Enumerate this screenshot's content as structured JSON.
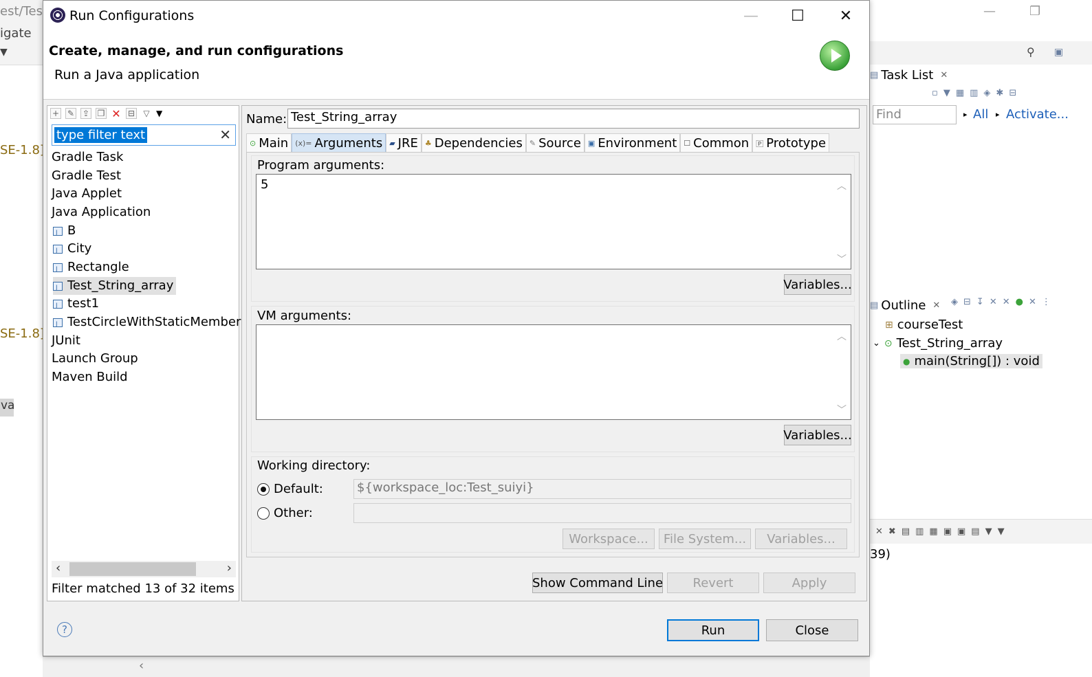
{
  "background": {
    "left_texts": [
      "est/Tes",
      "igate",
      "SE-1.8]",
      "SE-1.8]",
      "va"
    ],
    "task_list": {
      "title": "Task List",
      "find_placeholder": "Find",
      "all_link": "All",
      "activate_link": "Activate..."
    },
    "outline": {
      "title": "Outline",
      "items": [
        {
          "label": "courseTest"
        },
        {
          "label": "Test_String_array"
        },
        {
          "label": "main(String[]) : void"
        }
      ]
    },
    "console_text": "39)"
  },
  "dialog": {
    "title": "Run Configurations",
    "header_title": "Create, manage, and run configurations",
    "header_subtitle": "Run a Java application",
    "filter_placeholder": "type filter text",
    "tree": [
      {
        "label": "Gradle Task",
        "child": false
      },
      {
        "label": "Gradle Test",
        "child": false
      },
      {
        "label": "Java Applet",
        "child": false
      },
      {
        "label": "Java Application",
        "child": false
      },
      {
        "label": "B",
        "child": true
      },
      {
        "label": "City",
        "child": true
      },
      {
        "label": "Rectangle",
        "child": true
      },
      {
        "label": "Test_String_array",
        "child": true,
        "selected": true
      },
      {
        "label": "test1",
        "child": true
      },
      {
        "label": "TestCircleWithStaticMember",
        "child": true
      },
      {
        "label": "JUnit",
        "child": false
      },
      {
        "label": "Launch Group",
        "child": false
      },
      {
        "label": "Maven Build",
        "child": false
      }
    ],
    "filter_status": "Filter matched 13 of 32 items",
    "name_label": "Name:",
    "name_value": "Test_String_array",
    "tabs": [
      {
        "label": "Main",
        "icon": "main-tab-icon"
      },
      {
        "label": "Arguments",
        "icon": "arguments-tab-icon",
        "active": true
      },
      {
        "label": "JRE",
        "icon": "jre-tab-icon"
      },
      {
        "label": "Dependencies",
        "icon": "dependencies-tab-icon"
      },
      {
        "label": "Source",
        "icon": "source-tab-icon"
      },
      {
        "label": "Environment",
        "icon": "environment-tab-icon"
      },
      {
        "label": "Common",
        "icon": "common-tab-icon"
      },
      {
        "label": "Prototype",
        "icon": "prototype-tab-icon"
      }
    ],
    "program_args": {
      "label": "Program arguments:",
      "value": "5",
      "variables_button": "Variables..."
    },
    "vm_args": {
      "label": "VM arguments:",
      "value": "",
      "variables_button": "Variables..."
    },
    "working_dir": {
      "label": "Working directory:",
      "default_label": "Default:",
      "default_value": "${workspace_loc:Test_suiyi}",
      "other_label": "Other:",
      "other_value": "",
      "workspace_button": "Workspace...",
      "filesystem_button": "File System...",
      "variables_button": "Variables..."
    },
    "buttons": {
      "show_command_line": "Show Command Line",
      "revert": "Revert",
      "apply": "Apply",
      "run": "Run",
      "close": "Close",
      "help": "?"
    }
  }
}
